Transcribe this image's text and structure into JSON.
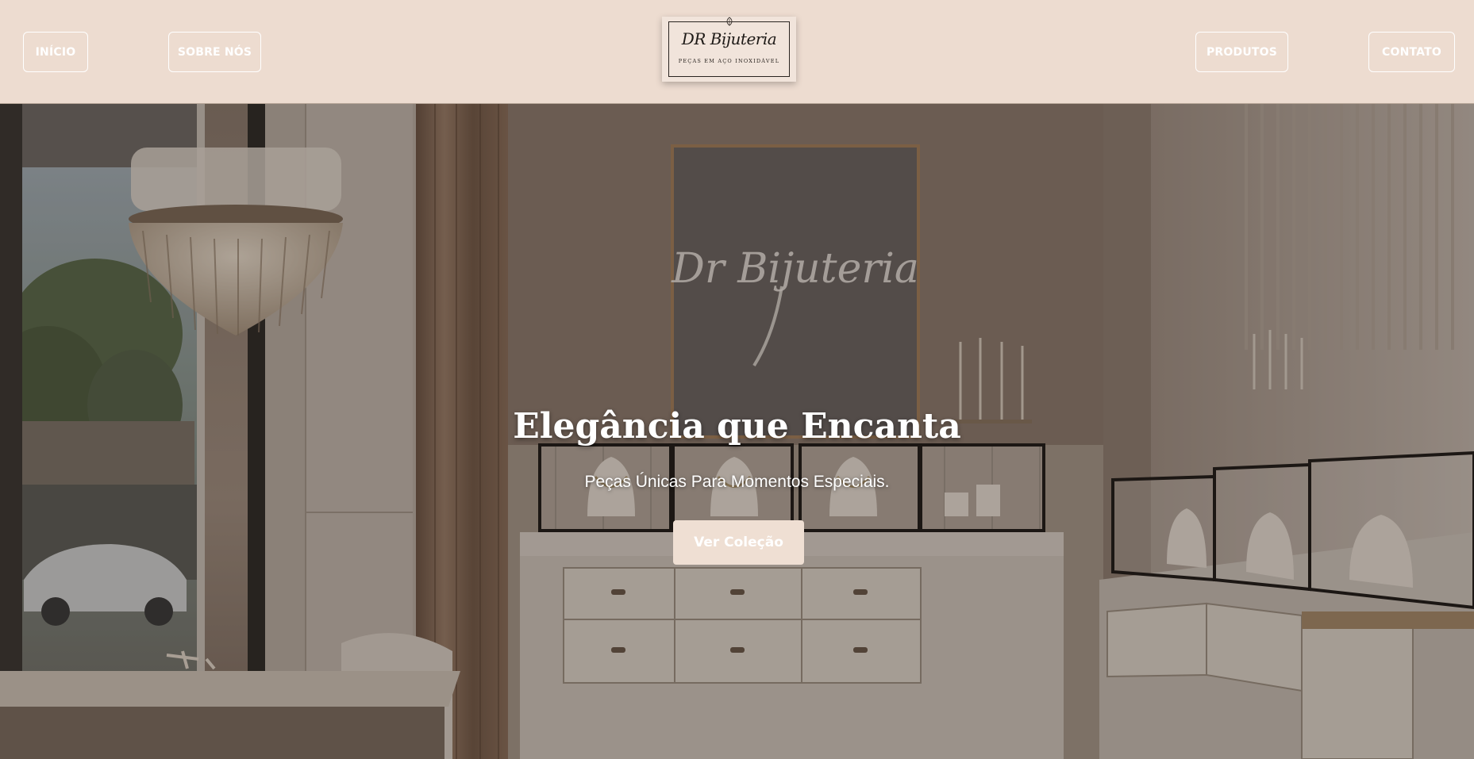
{
  "header": {
    "nav": {
      "inicio": "INÍCIO",
      "sobre": "SOBRE NÓS",
      "produtos": "PRODUTOS",
      "contato": "CONTATO"
    },
    "logo": {
      "name": "DR Bijuteria",
      "tagline": "PEÇAS EM AÇO INOXIDÁVEL"
    }
  },
  "hero": {
    "title": "Elegância que Encanta",
    "subtitle": "Peças Únicas Para Momentos Especiais.",
    "cta_label": "Ver Coleção",
    "background_sign": "Dr Bijuteria"
  },
  "colors": {
    "header_bg": "#eddcd0",
    "cta_bg": "#efdfd3",
    "nav_text": "#ffffff"
  }
}
